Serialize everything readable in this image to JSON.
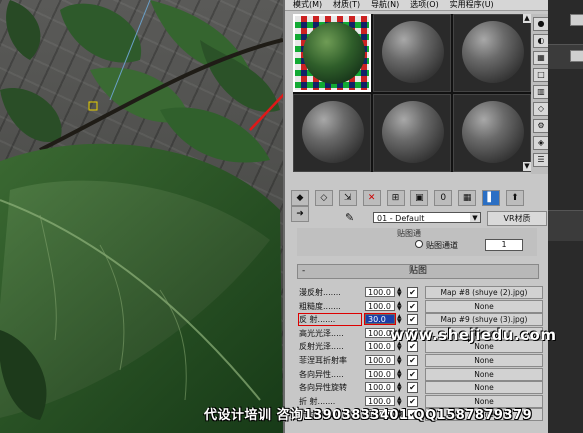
{
  "menu": {
    "items": [
      "模式(M)",
      "材质(T)",
      "导航(N)",
      "选项(O)",
      "实用程序(U)"
    ]
  },
  "slots": {
    "count": 6,
    "active_index": 0
  },
  "material_row": {
    "name": "01 - Default",
    "type": "VR材质"
  },
  "rollout_top": {
    "slot_label": "贴图通",
    "map_channel_label": "贴图通道",
    "map_channel_value": "1"
  },
  "maps": {
    "header": "贴图",
    "collapse": "-",
    "rows": [
      {
        "label": "漫反射.......",
        "amount": "100.0",
        "checked": "✔",
        "map": "Map #8 (shuye (2).jpg)"
      },
      {
        "label": "粗糙度.......",
        "amount": "100.0",
        "checked": "✔",
        "map": "None"
      },
      {
        "label": "反 射.......",
        "amount": "30.0",
        "checked": "✔",
        "map": "Map #9 (shuye (3).jpg)"
      },
      {
        "label": "高光光泽.....",
        "amount": "100.0",
        "checked": "✔",
        "map": "None"
      },
      {
        "label": "反射光泽.....",
        "amount": "100.0",
        "checked": "✔",
        "map": "None"
      },
      {
        "label": "菲涅耳折射率",
        "amount": "100.0",
        "checked": "✔",
        "map": "None"
      },
      {
        "label": "各向异性.....",
        "amount": "100.0",
        "checked": "✔",
        "map": "None"
      },
      {
        "label": "各向异性旋转",
        "amount": "100.0",
        "checked": "✔",
        "map": "None"
      },
      {
        "label": "折 射.......",
        "amount": "100.0",
        "checked": "✔",
        "map": "None"
      },
      {
        "label": "折射率.......",
        "amount": "100.0",
        "checked": "✔",
        "map": "None"
      }
    ]
  },
  "overlay": {
    "watermark": "www.shejiedu.com",
    "footer": "代设计培训 咨询13903833401 QQ1587879379"
  },
  "colors": {
    "panel_bg": "#c7c7c7",
    "highlight": "#1c3fa8",
    "annotation_red": "#dd0000"
  },
  "icons": [
    "sample-sphere-icon",
    "backlight-icon",
    "checker-bg-icon",
    "sample-uv-icon",
    "video-color-icon",
    "get-material-icon",
    "put-to-scene-icon",
    "assign-icon",
    "reset-icon",
    "make-unique-icon",
    "put-to-library-icon",
    "material-id-icon",
    "show-map-icon",
    "show-end-icon",
    "go-parent-icon",
    "go-sibling-icon",
    "eyedropper-icon"
  ]
}
